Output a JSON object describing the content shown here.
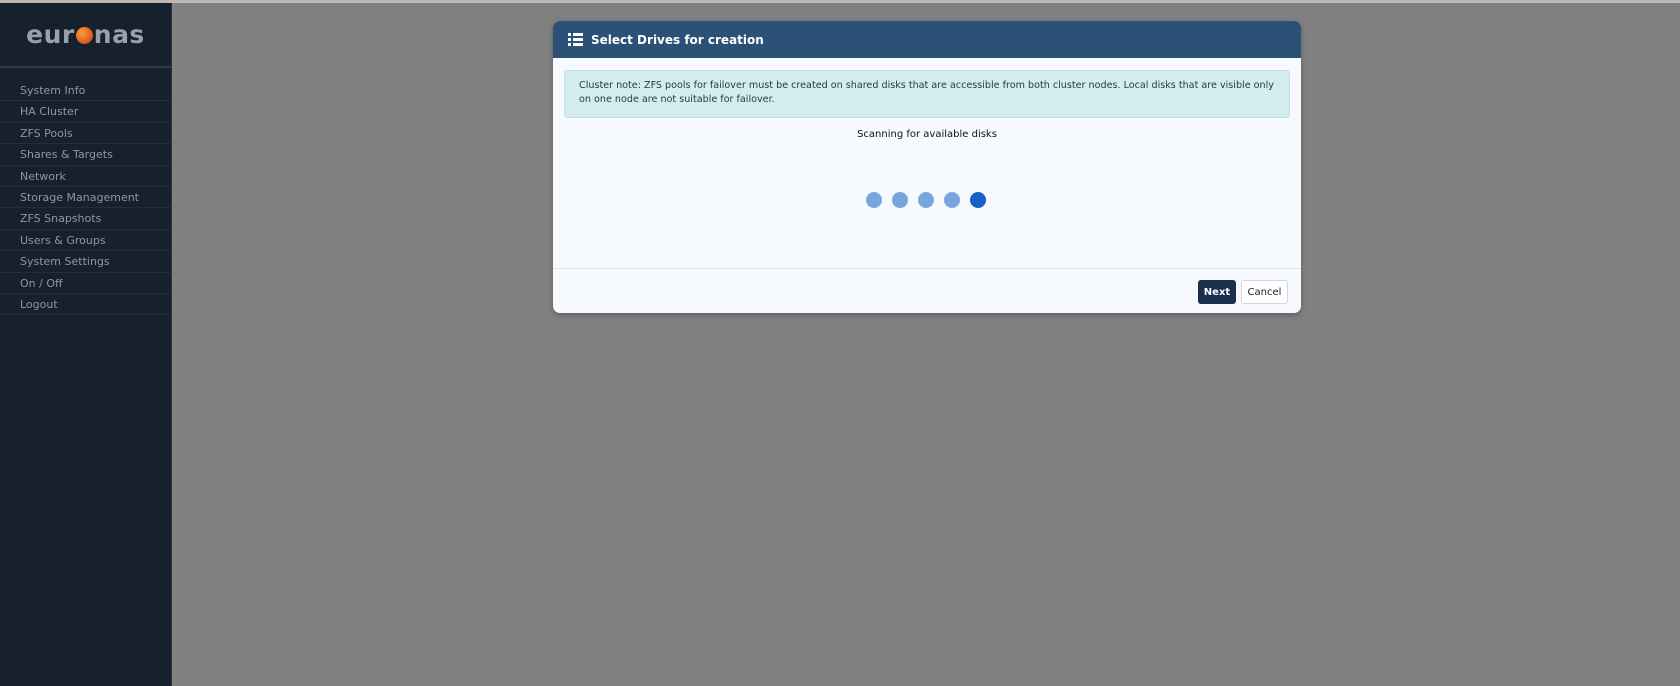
{
  "brand": {
    "logo_left": "eur",
    "logo_right": "nas"
  },
  "sidebar": {
    "items": [
      {
        "label": "System Info"
      },
      {
        "label": "HA Cluster"
      },
      {
        "label": "ZFS Pools"
      },
      {
        "label": "Shares & Targets"
      },
      {
        "label": "Network"
      },
      {
        "label": "Storage Management"
      },
      {
        "label": "ZFS Snapshots"
      },
      {
        "label": "Users & Groups"
      },
      {
        "label": "System Settings"
      },
      {
        "label": "On / Off"
      },
      {
        "label": "Logout"
      }
    ]
  },
  "modal": {
    "title": "Select Drives for creation",
    "title_icon": "list-icon",
    "alert": "Cluster note: ZFS pools for failover must be created on shared disks that are accessible from both cluster nodes. Local disks that are visible only on one node are not suitable for failover.",
    "status": "Scanning for available disks",
    "spinner": {
      "dot_count": 5,
      "active_dot": 5
    },
    "next_label": "Next",
    "cancel_label": "Cancel"
  },
  "colors": {
    "sidebar_bg": "#17212e",
    "modal_header": "#2c5177",
    "alert_bg": "#d4ebf0",
    "dot": "#78a6dc",
    "dot_active": "#1560c4",
    "next_button": "#1b2f4d",
    "backdrop": "#808080"
  }
}
